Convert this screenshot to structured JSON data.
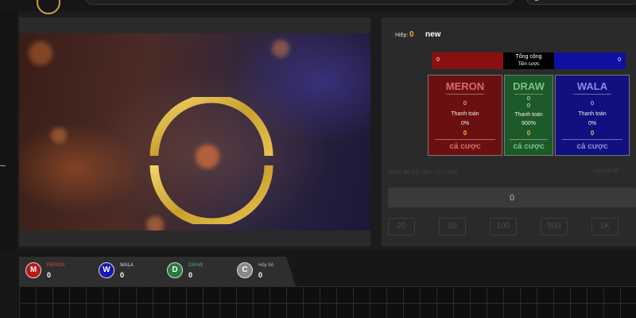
{
  "colors": {
    "meron": "#8a1010",
    "draw": "#1d5a2a",
    "wala": "#1010a0",
    "gold": "#e0b840",
    "cancel": "#888888"
  },
  "round": {
    "label": "Hiệp:",
    "number": "0",
    "status": "new"
  },
  "totals": {
    "meron_value": "0",
    "wala_value": "0",
    "label_line1": "Tổng cộng",
    "label_line2": "Tiền cược"
  },
  "cards": {
    "meron": {
      "title": "MERON",
      "total": "0",
      "payout_label": "Thanh toán",
      "percent": "0%",
      "amount": "0",
      "bet_label": "cá cược"
    },
    "draw": {
      "title": "DRAW",
      "total": "0",
      "total2": "0",
      "payout_label": "Thanh toán",
      "percent": "900%",
      "amount": "0",
      "bet_label": "cá cược"
    },
    "wala": {
      "title": "WALA",
      "total": "0",
      "payout_label": "Thanh toán",
      "percent": "0%",
      "amount": "0",
      "bet_label": "cá cược"
    }
  },
  "bet": {
    "hint": "Bấm để bắt đầu cá cược",
    "min_hint": "nhỏ nhất 20",
    "amount": "0"
  },
  "chips": [
    "20",
    "50",
    "100",
    "500",
    "1K"
  ],
  "scoreboard": [
    {
      "letter": "M",
      "name": "MERON",
      "value": "0",
      "color": "#b81818",
      "label_color": "#d94040"
    },
    {
      "letter": "W",
      "name": "WALA",
      "value": "0",
      "color": "#1818b0",
      "label_color": "#dddddd"
    },
    {
      "letter": "D",
      "name": "DRAW",
      "value": "0",
      "color": "#2a7a3a",
      "label_color": "#4caf6a"
    },
    {
      "letter": "C",
      "name": "Hủy bỏ",
      "value": "0",
      "color": "#888888",
      "label_color": "#bbbbbb"
    }
  ]
}
